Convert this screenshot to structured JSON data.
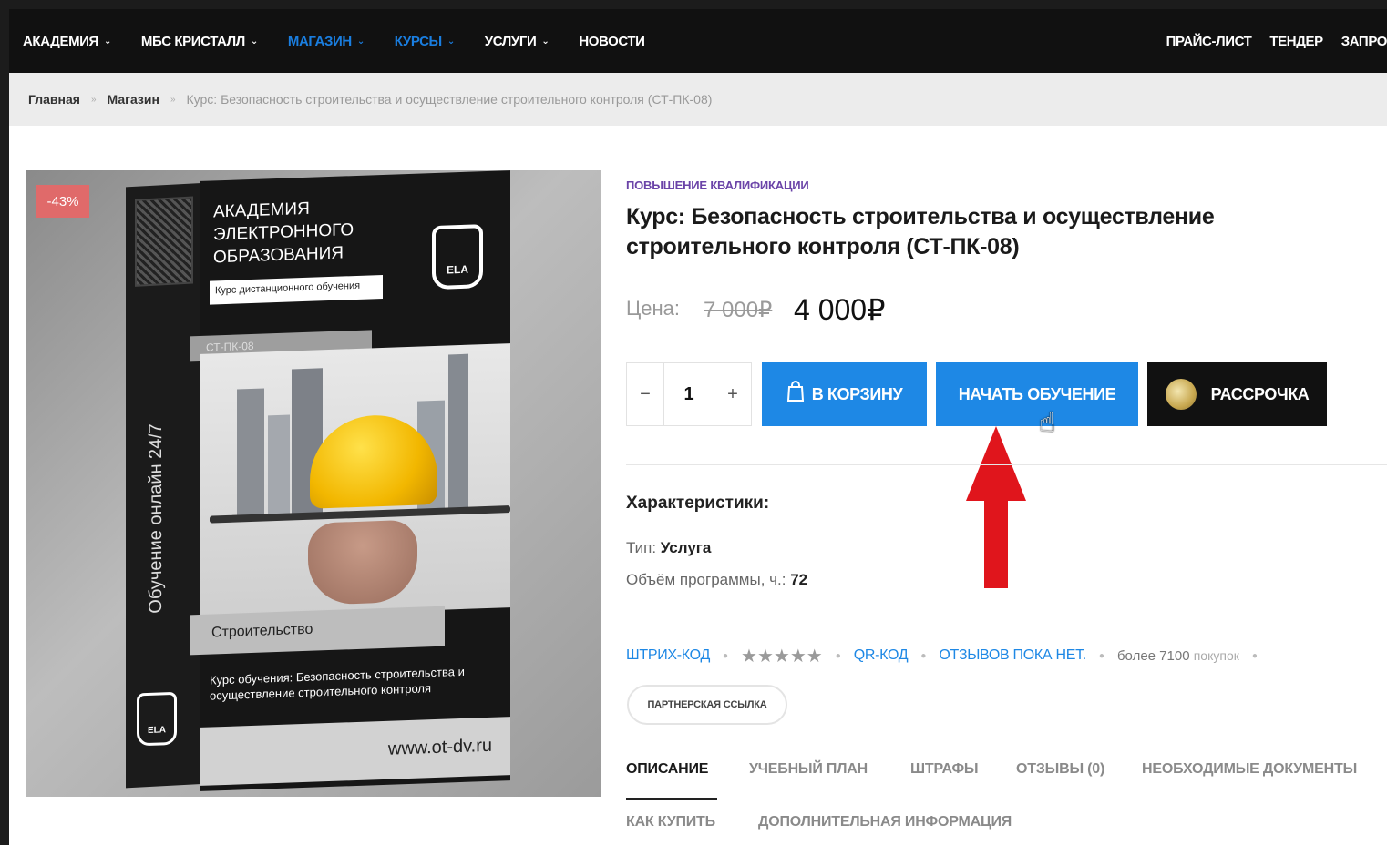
{
  "nav": {
    "left": [
      {
        "label": "АКАДЕМИЯ",
        "dropdown": true,
        "highlight": false
      },
      {
        "label": "МБС КРИСТАЛЛ",
        "dropdown": true,
        "highlight": false
      },
      {
        "label": "МАГАЗИН",
        "dropdown": true,
        "highlight": true
      },
      {
        "label": "КУРСЫ",
        "dropdown": true,
        "highlight": true
      },
      {
        "label": "УСЛУГИ",
        "dropdown": true,
        "highlight": false
      },
      {
        "label": "НОВОСТИ",
        "dropdown": false,
        "highlight": false
      }
    ],
    "right": [
      {
        "label": "ПРАЙС-ЛИСТ"
      },
      {
        "label": "ТЕНДЕР"
      },
      {
        "label": "ЗАПРО"
      }
    ],
    "chevron_icon": "chevron-down-icon",
    "accent_color": "#1a7ee0"
  },
  "breadcrumb": {
    "home": "Главная",
    "shop": "Магазин",
    "current": "Курс: Безопасность строительства и осуществление строительного контроля (СТ-ПК-08)",
    "separator": "»"
  },
  "product_image": {
    "sale_badge": "-43%",
    "side_text": "Обучение онлайн 24/7",
    "brand_line1": "АКАДЕМИЯ",
    "brand_line2": "ЭЛЕКТРОННОГО",
    "brand_line3": "ОБРАЗОВАНИЯ",
    "brand_sub": "Курс дистанционного обучения",
    "logo_text": "ELA",
    "code": "СТ-ПК-08",
    "topic": "Строительство",
    "course_text": "Курс обучения: Безопасность строительства и осуществление строительного контроля",
    "site": "www.ot-dv.ru"
  },
  "product": {
    "category": "ПОВЫШЕНИЕ КВАЛИФИКАЦИИ",
    "title_line1": "Курс: Безопасность строительства и осуществление",
    "title_line2": "строительного контроля (СТ-ПК-08)",
    "price_label": "Цена:",
    "price_old": "7 000₽",
    "price_new": "4 000₽"
  },
  "actions": {
    "qty_minus": "−",
    "qty_value": "1",
    "qty_plus": "+",
    "cart_label": "В КОРЗИНУ",
    "start_label": "НАЧАТЬ ОБУЧЕНИЕ",
    "installment_label": "РАССРОЧКА",
    "button_color": "#1e88e5",
    "arrow_color": "#e0151c"
  },
  "specs": {
    "title": "Характеристики:",
    "type_label": "Тип:",
    "type_value": "Услуга",
    "volume_label": "Объём программы, ч.:",
    "volume_value": "72"
  },
  "meta": {
    "barcode": "ШТРИХ-КОД",
    "stars": "★★★★★",
    "qr": "QR-КОД",
    "reviews": "ОТЗЫВОВ ПОКА НЕТ.",
    "sales_prefix": "более 7100",
    "sales_suffix": "покупок"
  },
  "partner_link": "ПАРТНЕРСКАЯ ССЫЛКА",
  "tabs": [
    {
      "label": "ОПИСАНИЕ",
      "active": true
    },
    {
      "label": "УЧЕБНЫЙ ПЛАН",
      "active": false
    },
    {
      "label": "ШТРАФЫ",
      "active": false
    },
    {
      "label": "ОТЗЫВЫ (0)",
      "active": false
    },
    {
      "label": "НЕОБХОДИМЫЕ ДОКУМЕНТЫ",
      "active": false
    },
    {
      "label": "КАК КУПИТЬ",
      "active": false
    },
    {
      "label": "ДОПОЛНИТЕЛЬНАЯ ИНФОРМАЦИЯ",
      "active": false
    }
  ]
}
